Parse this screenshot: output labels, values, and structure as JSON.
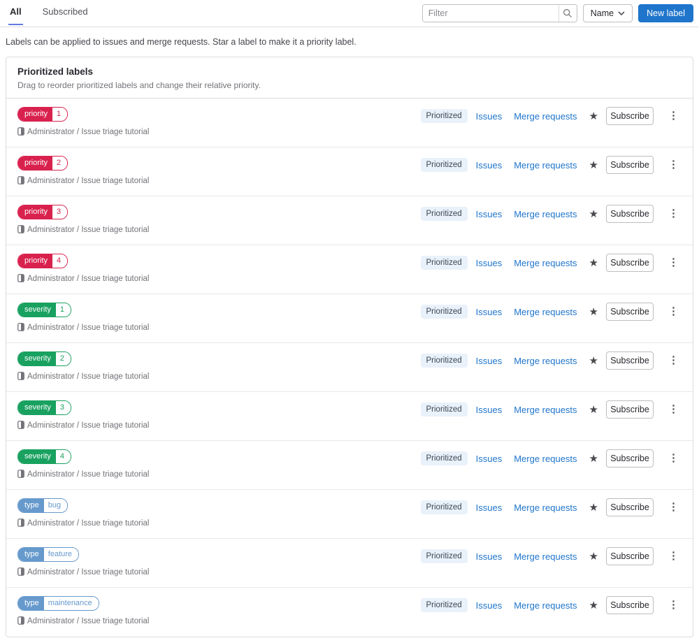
{
  "tabs": [
    {
      "label": "All",
      "active": true
    },
    {
      "label": "Subscribed",
      "active": false
    }
  ],
  "toolbar": {
    "filter_placeholder": "Filter",
    "sort_button_label": "Name",
    "new_label_button": "New label"
  },
  "description": "Labels can be applied to issues and merge requests. Star a label to make it a priority label.",
  "card": {
    "title": "Prioritized labels",
    "subtitle": "Drag to reorder prioritized labels and change their relative priority."
  },
  "row_common": {
    "project_path": "Administrator / Issue triage tutorial",
    "prioritized_badge": "Prioritized",
    "issues_link": "Issues",
    "merge_requests_link": "Merge requests",
    "subscribe_button": "Subscribe"
  },
  "icons": {
    "star": "★",
    "ellipsis": "⋮"
  },
  "colors": {
    "accent_blue": "#1f75cb",
    "tab_indicator": "#617ae2",
    "label_red": "#d9214e",
    "label_green": "#19a15f",
    "label_blue": "#6699cc",
    "prioritized_badge_bg": "#e9f1fa"
  },
  "labels": [
    {
      "scope": "priority",
      "value": "1",
      "color": "#d9214e"
    },
    {
      "scope": "priority",
      "value": "2",
      "color": "#d9214e"
    },
    {
      "scope": "priority",
      "value": "3",
      "color": "#d9214e"
    },
    {
      "scope": "priority",
      "value": "4",
      "color": "#d9214e"
    },
    {
      "scope": "severity",
      "value": "1",
      "color": "#19a15f"
    },
    {
      "scope": "severity",
      "value": "2",
      "color": "#19a15f"
    },
    {
      "scope": "severity",
      "value": "3",
      "color": "#19a15f"
    },
    {
      "scope": "severity",
      "value": "4",
      "color": "#19a15f"
    },
    {
      "scope": "type",
      "value": "bug",
      "color": "#6699cc"
    },
    {
      "scope": "type",
      "value": "feature",
      "color": "#6699cc"
    },
    {
      "scope": "type",
      "value": "maintenance",
      "color": "#6699cc"
    }
  ]
}
